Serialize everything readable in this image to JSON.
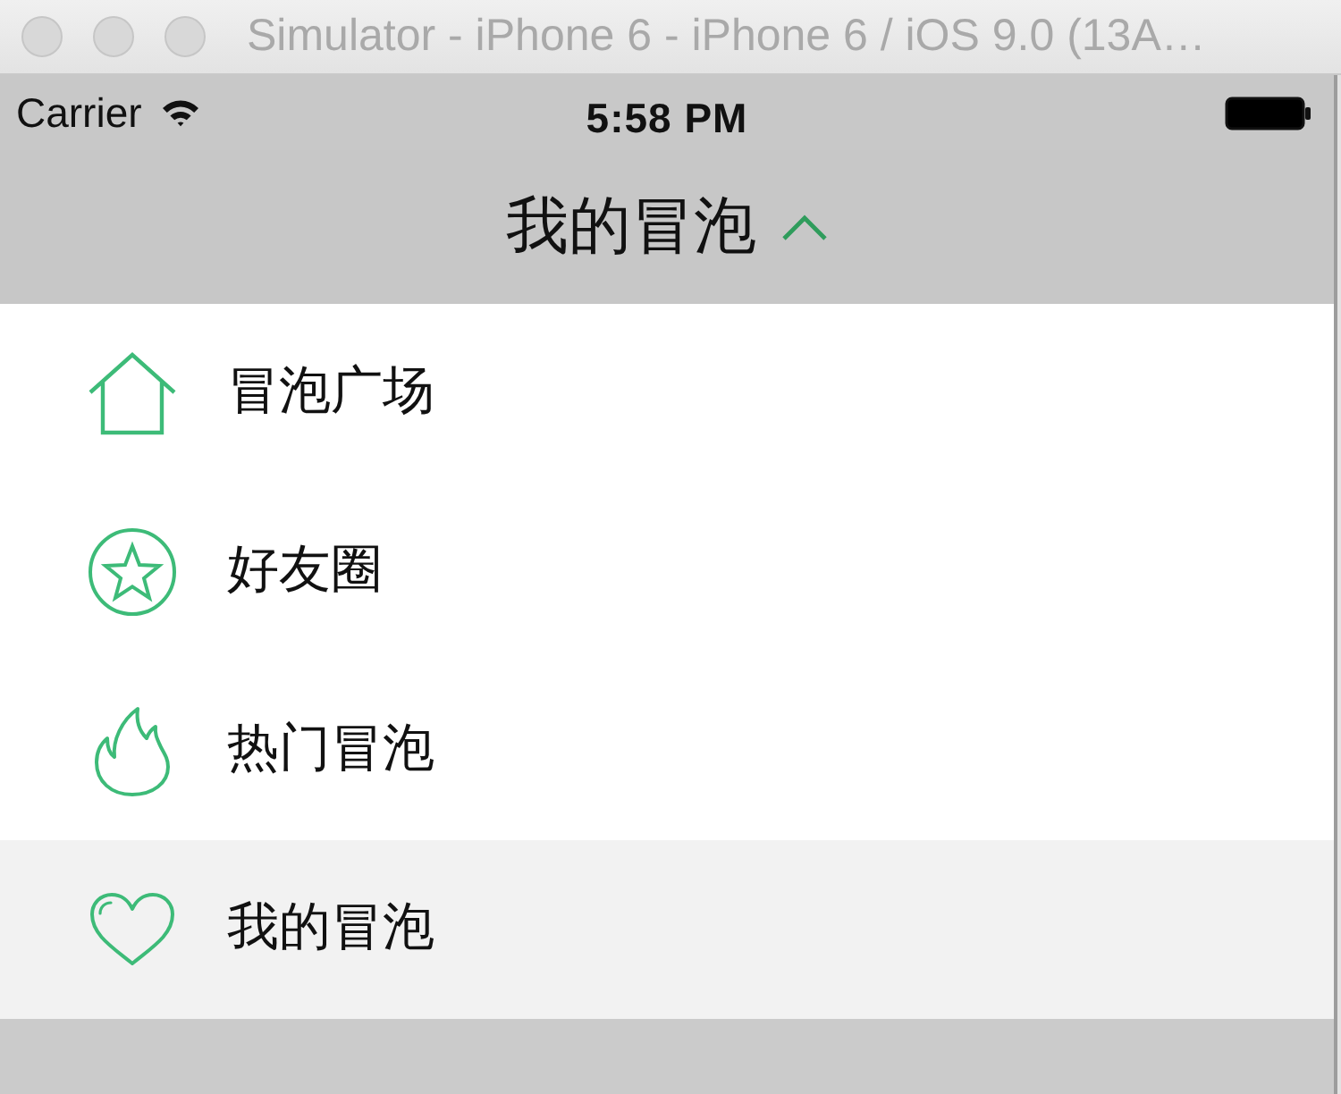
{
  "window": {
    "title": "Simulator - iPhone 6 - iPhone 6 / iOS 9.0 (13A…"
  },
  "status_bar": {
    "carrier": "Carrier",
    "time": "5:58 PM"
  },
  "nav_bar": {
    "title": "我的冒泡",
    "expanded": true
  },
  "menu": {
    "items": [
      {
        "kind": "house",
        "label": "冒泡广场",
        "selected": false
      },
      {
        "kind": "star",
        "label": "好友圈",
        "selected": false
      },
      {
        "kind": "flame",
        "label": "热门冒泡",
        "selected": false
      },
      {
        "kind": "heart",
        "label": "我的冒泡",
        "selected": true
      }
    ]
  }
}
